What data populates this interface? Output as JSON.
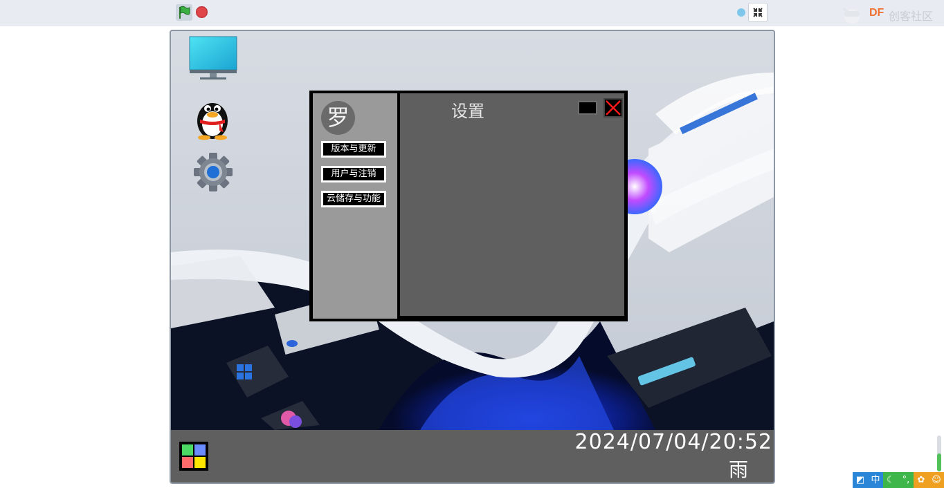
{
  "window": {
    "title": "设置",
    "avatar_char": "罗",
    "menu": [
      {
        "label": "版本与更新"
      },
      {
        "label": "用户与注销"
      },
      {
        "label": "云储存与功能"
      }
    ]
  },
  "taskbar": {
    "datetime": "2024/07/04/20:52",
    "weather": "雨"
  },
  "brand": {
    "df": "DF",
    "name": "创客社区"
  },
  "ime": {
    "mode": "中"
  },
  "icons": {
    "green_flag": "green-flag-icon",
    "stop": "stop-icon",
    "fullscreen": "fullscreen-exit-icon",
    "desktop_computer": "monitor-icon",
    "desktop_qq": "qq-penguin-icon",
    "desktop_settings": "gear-icon",
    "start": "windows-start-icon"
  },
  "colors": {
    "topbar": "#e8ecf2",
    "taskbar": "#5f5f5f",
    "window_main": "#5f5f5f",
    "window_side": "#9a9a9a",
    "close_x": "#ff1a1a",
    "brand_orange": "#f07030"
  }
}
